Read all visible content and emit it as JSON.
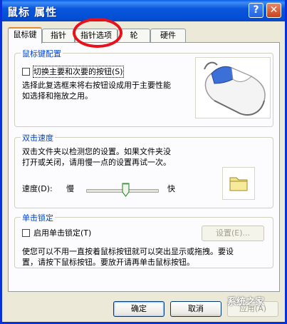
{
  "window": {
    "title": "鼠标 属性",
    "help_label": "?",
    "close_label": "✕"
  },
  "tabs": [
    {
      "label": "鼠标键",
      "active": true
    },
    {
      "label": "指针",
      "active": false
    },
    {
      "label": "指针选项",
      "active": false
    },
    {
      "label": "轮",
      "active": false
    },
    {
      "label": "硬件",
      "active": false
    }
  ],
  "buttons_config": {
    "title": "鼠标键配置",
    "swap_label": "切换主要和次要的按钮(S)",
    "swap_checked": false,
    "description_line1": "选择此复选框来将右按钮设成用于主要性能",
    "description_line2": "如选择和拖放之用。"
  },
  "double_click": {
    "title": "双击速度",
    "description_line1": "双击文件夹以检测您的设置。如果文件夹没",
    "description_line2": "打开或关闭，请用慢一点的设置再试一次。",
    "speed_label": "速度(D):",
    "slow_label": "慢",
    "fast_label": "快",
    "speed_fraction": 0.55
  },
  "click_lock": {
    "title": "单击锁定",
    "enable_label": "启用单击锁定(T)",
    "enable_checked": false,
    "settings_label": "设置(E)...",
    "description_line1": "使您可以不用一直按着鼠标按钮就可以突出显示或拖拽。要设",
    "description_line2": "置，请按下鼠标按钮。要放开请再单击鼠标按钮。"
  },
  "footer": {
    "ok_label": "确定",
    "cancel_label": "取消",
    "apply_label": "应用(A)"
  },
  "watermark": "系统之家",
  "colors": {
    "title_bar": "#0a56dc",
    "group_title": "#0046d5",
    "highlight_circle": "#e8101a",
    "tab_active_accent": "#e68b2c"
  }
}
